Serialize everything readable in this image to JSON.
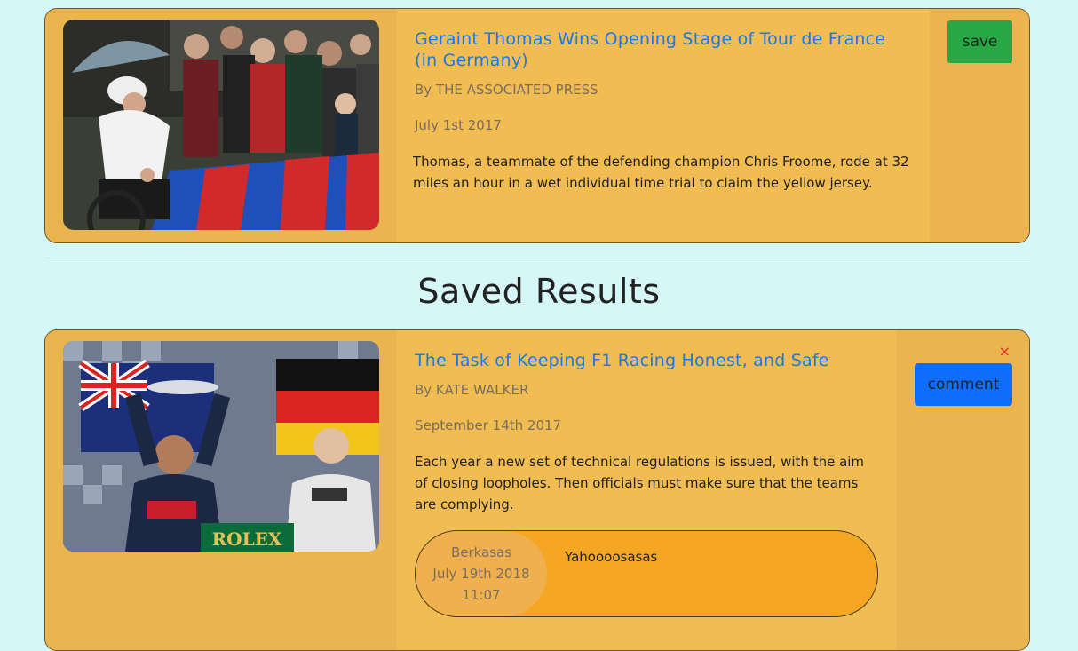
{
  "search_result": {
    "headline": "Geraint Thomas Wins Opening Stage of Tour de France (in Germany)",
    "byline": "By THE ASSOCIATED PRESS",
    "date": "July 1st 2017",
    "snippet": "Thomas, a teammate of the defending champion Chris Froome, rode at 32 miles an hour in a wet individual time trial to claim the yellow jersey.",
    "save_label": "save"
  },
  "saved_section": {
    "title": "Saved Results"
  },
  "saved_article": {
    "headline": "The Task of Keeping F1 Racing Honest, and Safe",
    "byline": "By KATE WALKER",
    "date": "September 14th 2017",
    "snippet": "Each year a new set of technical regulations is issued, with the aim of closing loopholes. Then officials must make sure that the teams are complying.",
    "comment_label": "comment",
    "close_symbol": "×",
    "comment": {
      "author": "Berkasas",
      "date": "July 19th 2018",
      "time": "11:07",
      "text": "Yahoooosasas"
    },
    "rolex_text": "ROLEX"
  },
  "colors": {
    "page_bg": "#d6f7f7",
    "card_bg": "#eab54e",
    "headline": "#1877f2",
    "save": "#28a745",
    "comment": "#0d6efd",
    "close": "#e02b2b",
    "bubble": "#f5a623"
  }
}
